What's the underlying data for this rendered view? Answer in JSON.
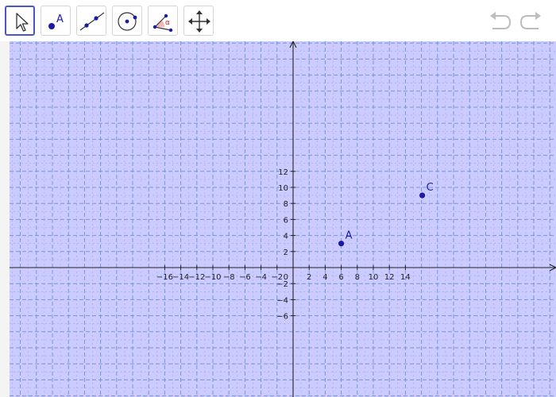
{
  "toolbar": {
    "tools": [
      {
        "name": "move-tool",
        "active": true
      },
      {
        "name": "point-tool",
        "label": "A",
        "active": false
      },
      {
        "name": "line-tool",
        "active": false
      },
      {
        "name": "circle-tool",
        "active": false
      },
      {
        "name": "angle-tool",
        "label": "α",
        "active": false
      },
      {
        "name": "move-graphics-view-tool",
        "active": false
      }
    ],
    "undo_icon": "undo-icon",
    "redo_icon": "redo-icon"
  },
  "graphics": {
    "background_color": "#cccbff",
    "grid_color": "#6f8fd6",
    "axis_color": "#222222",
    "point_color": "#1a1aa8",
    "x_tick_labels": [
      "−16",
      "−14",
      "−12",
      "−10",
      "−8",
      "−6",
      "−4",
      "−2",
      "2",
      "4",
      "6",
      "8",
      "10",
      "12",
      "14"
    ],
    "x_tick_values": [
      -16,
      -14,
      -12,
      -10,
      -8,
      -6,
      -4,
      -2,
      2,
      4,
      6,
      8,
      10,
      12,
      14
    ],
    "y_tick_labels": [
      "12",
      "10",
      "8",
      "6",
      "4",
      "2",
      "−2",
      "−4",
      "−6"
    ],
    "y_tick_values": [
      12,
      10,
      8,
      6,
      4,
      2,
      -2,
      -4,
      -6
    ],
    "origin_label": "0",
    "points": [
      {
        "label": "A",
        "x": 6,
        "y": 3
      },
      {
        "label": "C",
        "x": 16.1,
        "y": 9
      }
    ]
  }
}
